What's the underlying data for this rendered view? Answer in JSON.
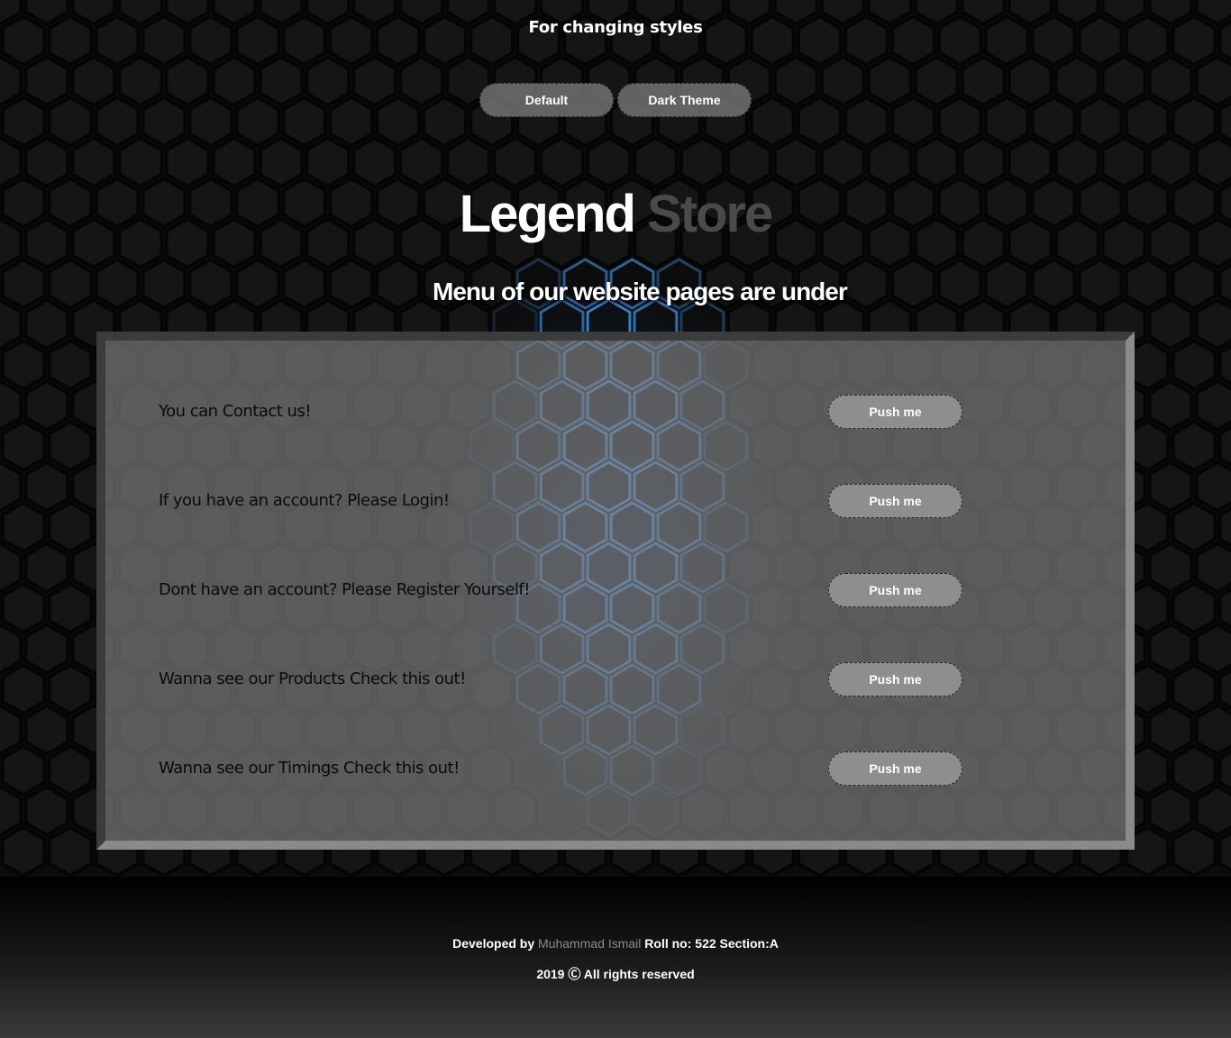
{
  "header": {
    "caption": "For changing styles",
    "theme_buttons": [
      {
        "label": "Default"
      },
      {
        "label": "Dark Theme"
      }
    ]
  },
  "brand": {
    "word1": "Legend",
    "word2": "Store"
  },
  "menu": {
    "heading": "Menu of our website pages are under",
    "items": [
      {
        "text": "You can Contact us!",
        "button": "Push me"
      },
      {
        "text": "If you have an account? Please Login!",
        "button": "Push me"
      },
      {
        "text": "Dont have an account? Please Register Yourself!",
        "button": "Push me"
      },
      {
        "text": "Wanna see our Products Check this out!",
        "button": "Push me"
      },
      {
        "text": "Wanna see our Timings Check this out!",
        "button": "Push me"
      }
    ]
  },
  "footer": {
    "developed_prefix": "Developed by",
    "developer_name": "Muhammad Ismail",
    "developed_suffix": "Roll no: 522 Section:A",
    "copyright": "2019 Ⓒ All rights reserved"
  },
  "colors": {
    "background": "#0c0c0c",
    "hex_accent": "#4da3ff",
    "panel": "#787878",
    "button": "#8e8e8e",
    "store_word": "#4a4a4a"
  }
}
